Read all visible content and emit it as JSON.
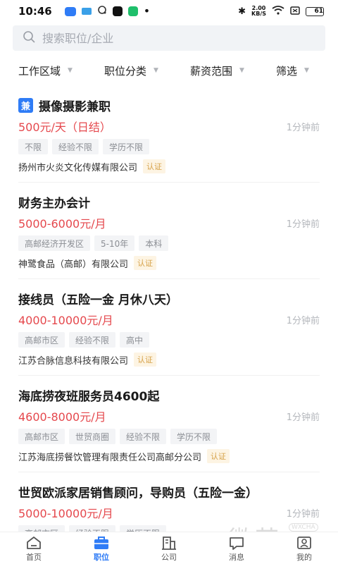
{
  "status_bar": {
    "time": "10:46",
    "net_speed": "2.00",
    "net_unit": "KB/S",
    "battery": "61"
  },
  "search": {
    "placeholder": "搜索职位/企业"
  },
  "filters": [
    {
      "label": "工作区域"
    },
    {
      "label": "职位分类"
    },
    {
      "label": "薪资范围"
    },
    {
      "label": "筛选"
    }
  ],
  "jobs": [
    {
      "badge": "兼",
      "title": "摄像摄影兼职",
      "salary": "500元/天（日结）",
      "time": "1分钟前",
      "tags": [
        "不限",
        "经验不限",
        "学历不限"
      ],
      "company": "扬州市火炎文化传媒有限公司",
      "verified": "认证"
    },
    {
      "title": "财务主办会计",
      "salary": "5000-6000元/月",
      "time": "1分钟前",
      "tags": [
        "高邮经济开发区",
        "5-10年",
        "本科"
      ],
      "company": "神鹭食品（高邮）有限公司",
      "verified": "认证"
    },
    {
      "title": "接线员（五险一金 月休八天）",
      "salary": "4000-10000元/月",
      "time": "1分钟前",
      "tags": [
        "高邮市区",
        "经验不限",
        "高中"
      ],
      "company": "江苏合脉信息科技有限公司",
      "verified": "认证"
    },
    {
      "title": "海底捞夜班服务员4600起",
      "salary": "4600-8000元/月",
      "time": "1分钟前",
      "tags": [
        "高邮市区",
        "世贸商圈",
        "经验不限",
        "学历不限"
      ],
      "company": "江苏海底捞餐饮管理有限责任公司高邮分公司",
      "verified": "认证"
    },
    {
      "title": "世贸欧派家居销售顾问，导购员（五险一金）",
      "salary": "5000-10000元/月",
      "time": "1分钟前",
      "tags": [
        "高邮市区",
        "经验不限",
        "学历不限"
      ]
    }
  ],
  "tabbar": [
    {
      "label": "首页",
      "icon": "home-icon"
    },
    {
      "label": "职位",
      "icon": "briefcase-icon"
    },
    {
      "label": "公司",
      "icon": "building-icon"
    },
    {
      "label": "消息",
      "icon": "message-icon"
    },
    {
      "label": "我的",
      "icon": "profile-icon"
    }
  ],
  "watermark": {
    "text": "微茶",
    "sub": "WXCHA"
  },
  "colors": {
    "accent": "#2f7cf6",
    "salary": "#e5484d",
    "verified": "#d6a24a"
  }
}
